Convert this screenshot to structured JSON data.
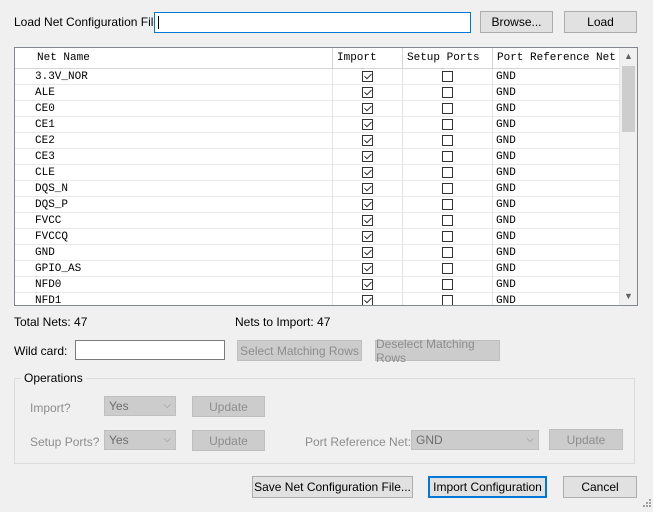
{
  "top": {
    "file_label": "Load Net Configuration File",
    "file_value": "",
    "browse_label": "Browse...",
    "load_label": "Load"
  },
  "grid": {
    "columns": [
      "Net Name",
      "Import",
      "Setup Ports",
      "Port Reference Net"
    ],
    "rows": [
      {
        "name": "3.3V_NOR",
        "import": true,
        "setup": false,
        "ref": "GND"
      },
      {
        "name": "ALE",
        "import": true,
        "setup": false,
        "ref": "GND"
      },
      {
        "name": "CE0",
        "import": true,
        "setup": false,
        "ref": "GND"
      },
      {
        "name": "CE1",
        "import": true,
        "setup": false,
        "ref": "GND"
      },
      {
        "name": "CE2",
        "import": true,
        "setup": false,
        "ref": "GND"
      },
      {
        "name": "CE3",
        "import": true,
        "setup": false,
        "ref": "GND"
      },
      {
        "name": "CLE",
        "import": true,
        "setup": false,
        "ref": "GND"
      },
      {
        "name": "DQS_N",
        "import": true,
        "setup": false,
        "ref": "GND"
      },
      {
        "name": "DQS_P",
        "import": true,
        "setup": false,
        "ref": "GND"
      },
      {
        "name": "FVCC",
        "import": true,
        "setup": false,
        "ref": "GND"
      },
      {
        "name": "FVCCQ",
        "import": true,
        "setup": false,
        "ref": "GND"
      },
      {
        "name": "GND",
        "import": true,
        "setup": false,
        "ref": "GND"
      },
      {
        "name": "GPIO_AS",
        "import": true,
        "setup": false,
        "ref": "GND"
      },
      {
        "name": "NFD0",
        "import": true,
        "setup": false,
        "ref": "GND"
      },
      {
        "name": "NFD1",
        "import": true,
        "setup": false,
        "ref": "GND"
      }
    ]
  },
  "stats": {
    "total_nets": "Total Nets: 47",
    "nets_to_import": "Nets to Import: 47"
  },
  "wildcard": {
    "label": "Wild card:",
    "value": "",
    "select_label": "Select Matching Rows",
    "deselect_label": "Deselect Matching Rows"
  },
  "operations": {
    "title": "Operations",
    "import_label": "Import?",
    "import_value": "Yes",
    "update1": "Update",
    "setup_label": "Setup Ports?",
    "setup_value": "Yes",
    "update2": "Update",
    "portref_label": "Port Reference Net:",
    "portref_value": "GND",
    "update3": "Update"
  },
  "footer": {
    "save_label": "Save Net Configuration File...",
    "import_label": "Import Configuration",
    "cancel_label": "Cancel"
  }
}
